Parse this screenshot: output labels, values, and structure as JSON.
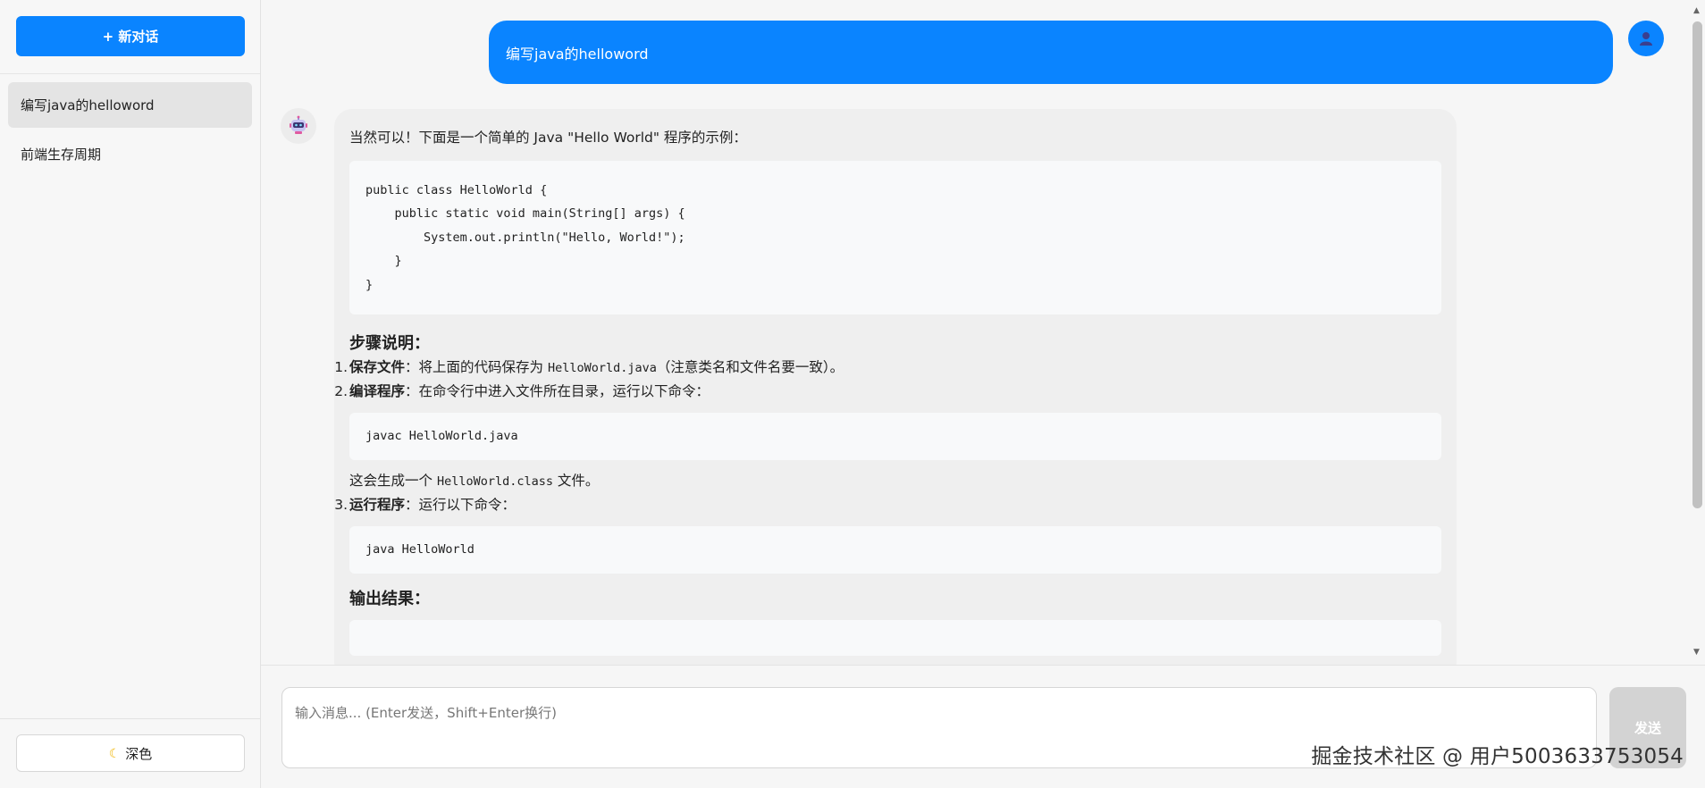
{
  "sidebar": {
    "new_chat_label": "+ 新对话",
    "conversations": [
      {
        "title": "编写java的helloword",
        "active": true
      },
      {
        "title": "前端生存周期",
        "active": false
      }
    ],
    "theme_toggle_label": "深色",
    "theme_icon": "moon-icon"
  },
  "chat": {
    "user_message": "编写java的helloword",
    "assistant": {
      "intro": "当然可以！下面是一个简单的 Java \"Hello World\" 程序的示例：",
      "code_main": [
        "public class HelloWorld {",
        "    public static void main(String[] args) {",
        "        System.out.println(\"Hello, World!\");",
        "    }",
        "}"
      ],
      "steps_heading": "步骤说明：",
      "step1_num": "1.",
      "step1_bold": "保存文件",
      "step1_text_a": "：将上面的代码保存为 ",
      "step1_code": "HelloWorld.java",
      "step1_text_b": "（注意类名和文件名要一致）。",
      "step2_num": "2.",
      "step2_bold": "编译程序",
      "step2_text": "：在命令行中进入文件所在目录，运行以下命令：",
      "code_compile": "javac HelloWorld.java",
      "compile_note_a": "这会生成一个 ",
      "compile_note_code": "HelloWorld.class",
      "compile_note_b": " 文件。",
      "step3_num": "3.",
      "step3_bold": "运行程序",
      "step3_text": "：运行以下命令：",
      "code_run": "java HelloWorld",
      "output_heading": "输出结果："
    }
  },
  "input": {
    "placeholder": "输入消息... (Enter发送，Shift+Enter换行)",
    "value": "",
    "send_label": "发送"
  },
  "watermark": "掘金技术社区 @ 用户5003633753054",
  "colors": {
    "accent": "#0a84ff",
    "sidebar_bg": "#f7f7f7",
    "bot_bubble": "#efefef",
    "code_bg": "#f8f9fa",
    "send_disabled": "#d3d3d3"
  }
}
